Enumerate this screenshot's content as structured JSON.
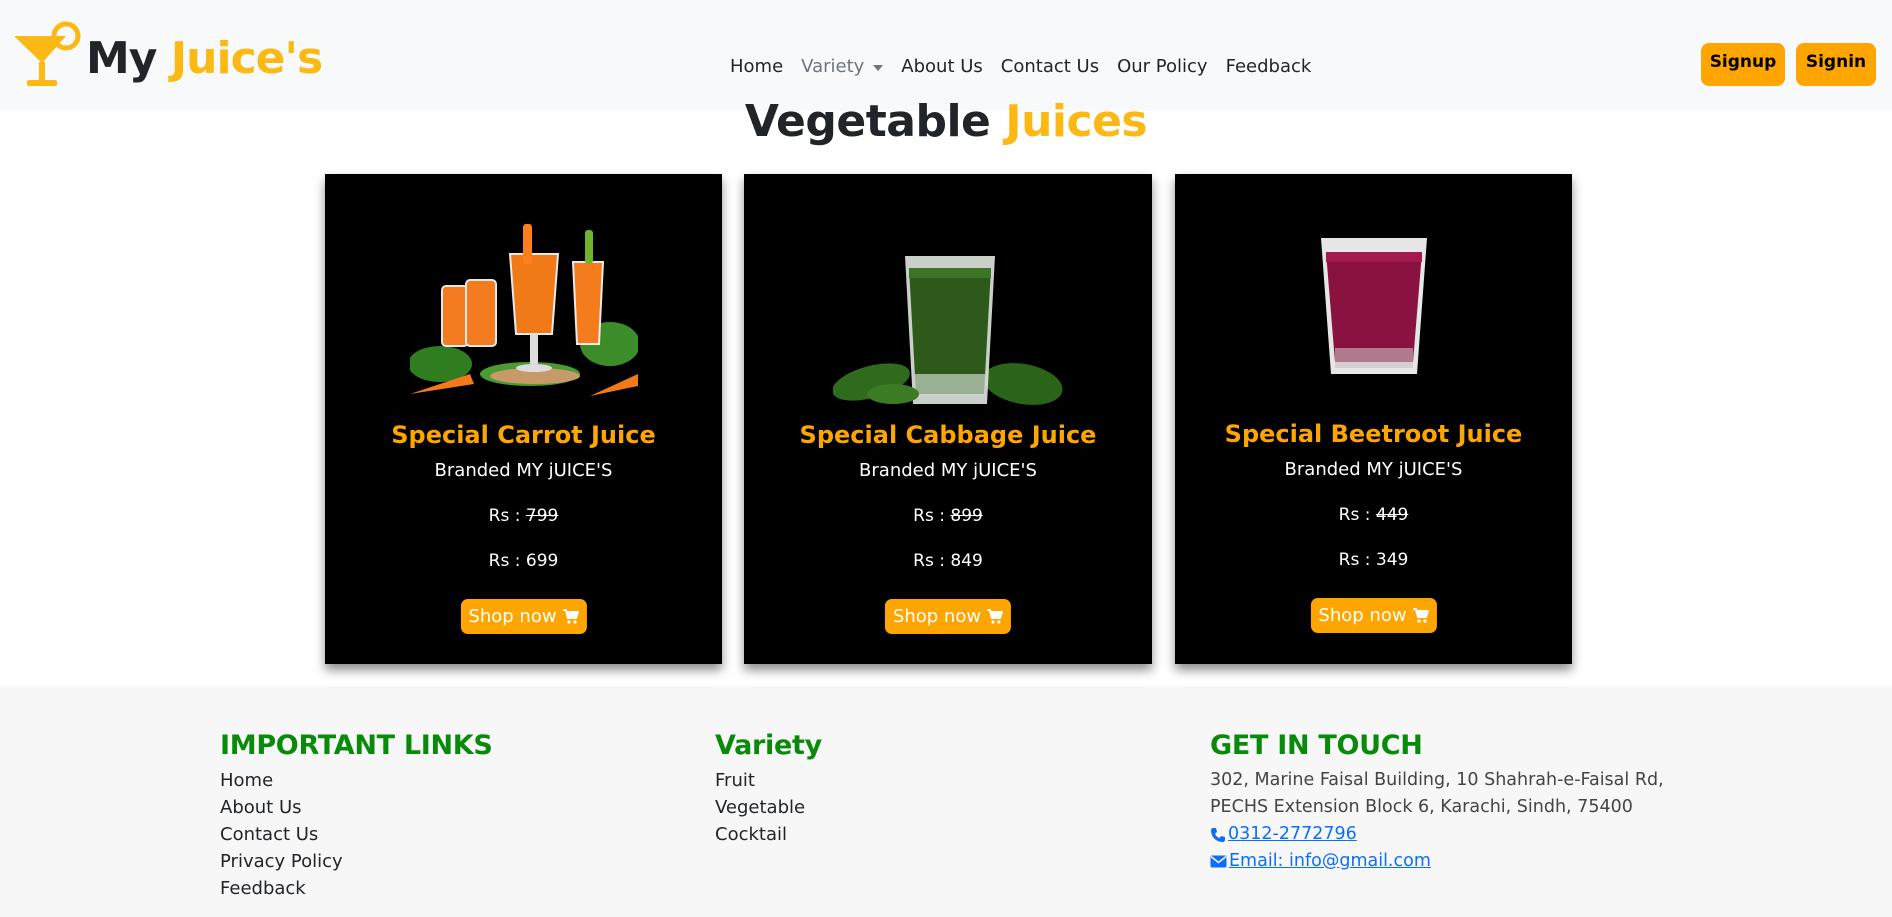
{
  "brand": {
    "part1": "My",
    "part2": "Juice's"
  },
  "nav": {
    "home": "Home",
    "variety": "Variety",
    "about": "About Us",
    "contact": "Contact Us",
    "policy": "Our Policy",
    "feedback": "Feedback"
  },
  "auth": {
    "signup": "Signup",
    "signin": "Signin"
  },
  "section": {
    "title_part1": "Vegetable",
    "title_part2": "Juices"
  },
  "products": [
    {
      "name": "Special Carrot Juice",
      "brand": "Branded MY jUICE'S",
      "old_prefix": "Rs :",
      "old_price": "799",
      "new_price": "Rs : 699",
      "button": "Shop now",
      "image_icon": "carrot-juice-image"
    },
    {
      "name": "Special Cabbage Juice",
      "brand": "Branded MY jUICE'S",
      "old_prefix": "Rs :",
      "old_price": "899",
      "new_price": "Rs : 849",
      "button": "Shop now",
      "image_icon": "cabbage-juice-image"
    },
    {
      "name": "Special Beetroot Juice",
      "brand": "Branded MY jUICE'S",
      "old_prefix": "Rs :",
      "old_price": "449",
      "new_price": "Rs : 349",
      "button": "Shop now",
      "image_icon": "beetroot-juice-image"
    }
  ],
  "footer": {
    "links_heading": "IMPORTANT LINKS",
    "links": [
      "Home",
      "About Us",
      "Contact Us",
      "Privacy Policy",
      "Feedback"
    ],
    "variety_heading": "Variety",
    "variety": [
      "Fruit",
      "Vegetable",
      "Cocktail"
    ],
    "contact_heading": "GET IN TOUCH",
    "address_line1": "302, Marine Faisal Building, 10 Shahrah-e-Faisal Rd,",
    "address_line2": "PECHS Extension Block 6, Karachi, Sindh, 75400",
    "phone": " 0312-2772796",
    "email": " Email: info@gmail.com"
  },
  "colors": {
    "accent": "#ffa500",
    "brand_yellow": "#fdb913",
    "footer_heading": "#0a8a0a",
    "link_blue": "#0d6efd",
    "card_bg": "#000000"
  }
}
